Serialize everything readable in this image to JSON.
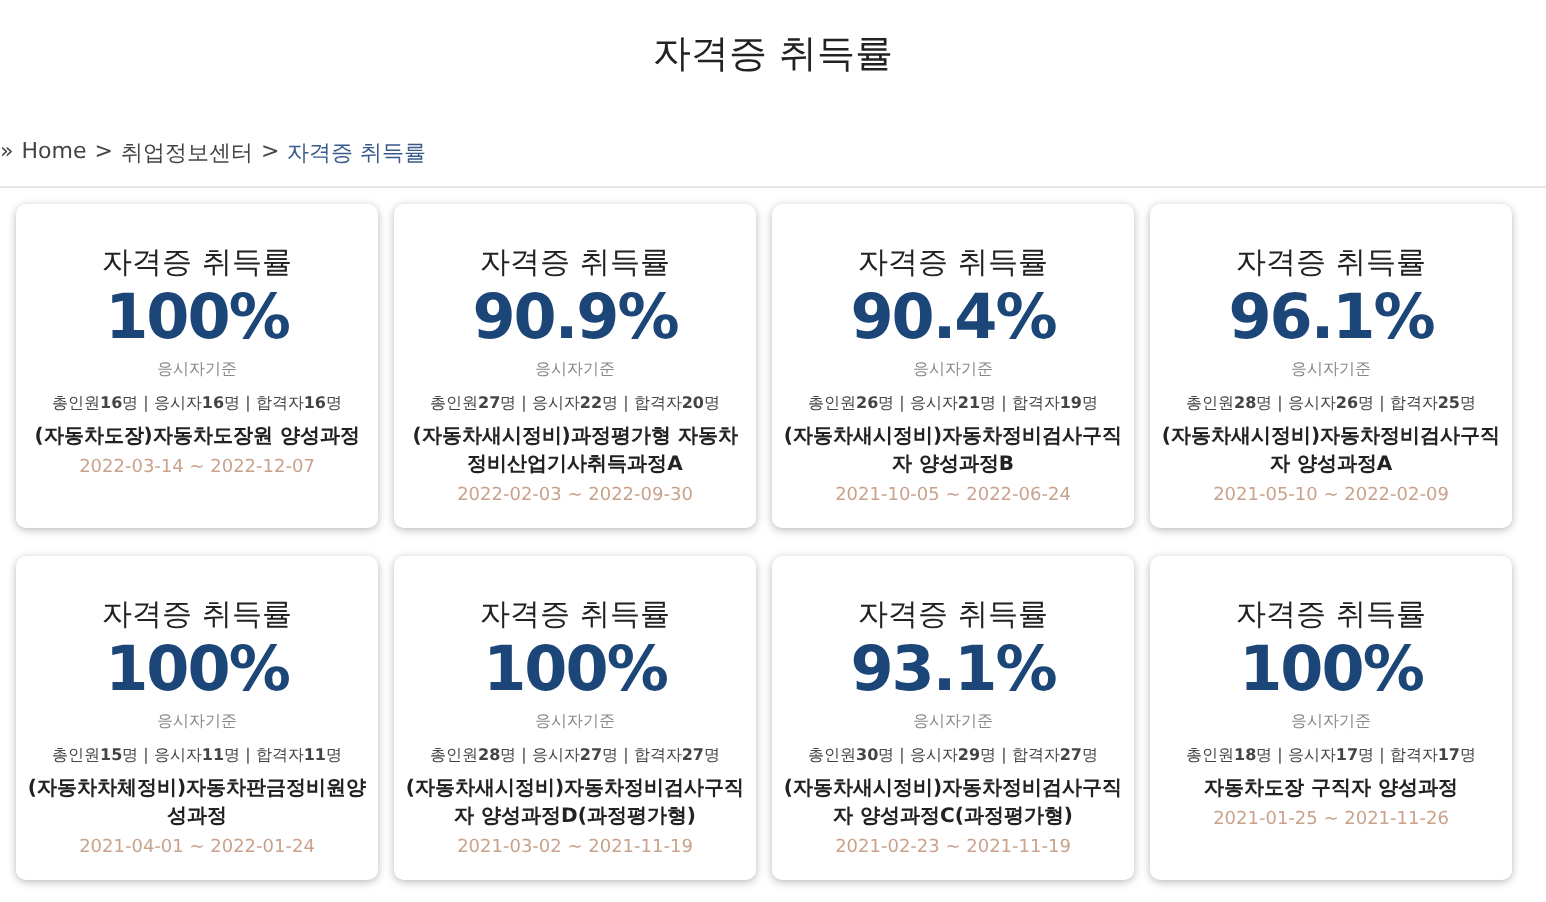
{
  "page_title": "자격증 취득률",
  "breadcrumb": {
    "prefix": "»",
    "separator": ">",
    "items": [
      {
        "label": "Home",
        "current": false
      },
      {
        "label": "취업정보센터",
        "current": false
      },
      {
        "label": "자격증 취득률",
        "current": true
      }
    ]
  },
  "cards": [
    {
      "title": "자격증 취득률",
      "rate": "100%",
      "basis": "응시자기준",
      "stats": "총인원**16**명 | 응시자**16**명 | 합격자**16**명",
      "course": "(자동차도장)자동차도장원 양성과정",
      "period": "2022-03-14 ~ 2022-12-07"
    },
    {
      "title": "자격증 취득률",
      "rate": "90.9%",
      "basis": "응시자기준",
      "stats": "총인원**27**명 | 응시자**22**명 | 합격자**20**명",
      "course": "(자동차새시정비)과정평가형 자동차정비산업기사취득과정A",
      "period": "2022-02-03 ~ 2022-09-30"
    },
    {
      "title": "자격증 취득률",
      "rate": "90.4%",
      "basis": "응시자기준",
      "stats": "총인원**26**명 | 응시자**21**명 | 합격자**19**명",
      "course": "(자동차새시정비)자동차정비검사구직자 양성과정B",
      "period": "2021-10-05 ~ 2022-06-24"
    },
    {
      "title": "자격증 취득률",
      "rate": "96.1%",
      "basis": "응시자기준",
      "stats": "총인원**28**명 | 응시자**26**명 | 합격자**25**명",
      "course": "(자동차새시정비)자동차정비검사구직자 양성과정A",
      "period": "2021-05-10 ~ 2022-02-09"
    },
    {
      "title": "자격증 취득률",
      "rate": "100%",
      "basis": "응시자기준",
      "stats": "총인원**15**명 | 응시자**11**명 | 합격자**11**명",
      "course": "(자동차차체정비)자동차판금정비원양성과정",
      "period": "2021-04-01 ~ 2022-01-24"
    },
    {
      "title": "자격증 취득률",
      "rate": "100%",
      "basis": "응시자기준",
      "stats": "총인원**28**명 | 응시자**27**명 | 합격자**27**명",
      "course": "(자동차새시정비)자동차정비검사구직자 양성과정D(과정평가형)",
      "period": "2021-03-02 ~ 2021-11-19"
    },
    {
      "title": "자격증 취득률",
      "rate": "93.1%",
      "basis": "응시자기준",
      "stats": "총인원**30**명 | 응시자**29**명 | 합격자**27**명",
      "course": "(자동차새시정비)자동차정비검사구직자 양성과정C(과정평가형)",
      "period": "2021-02-23 ~ 2021-11-19"
    },
    {
      "title": "자격증 취득률",
      "rate": "100%",
      "basis": "응시자기준",
      "stats": "총인원**18**명 | 응시자**17**명 | 합격자**17**명",
      "course": "자동차도장 구직자 양성과정",
      "period": "2021-01-25 ~ 2021-11-26"
    }
  ]
}
